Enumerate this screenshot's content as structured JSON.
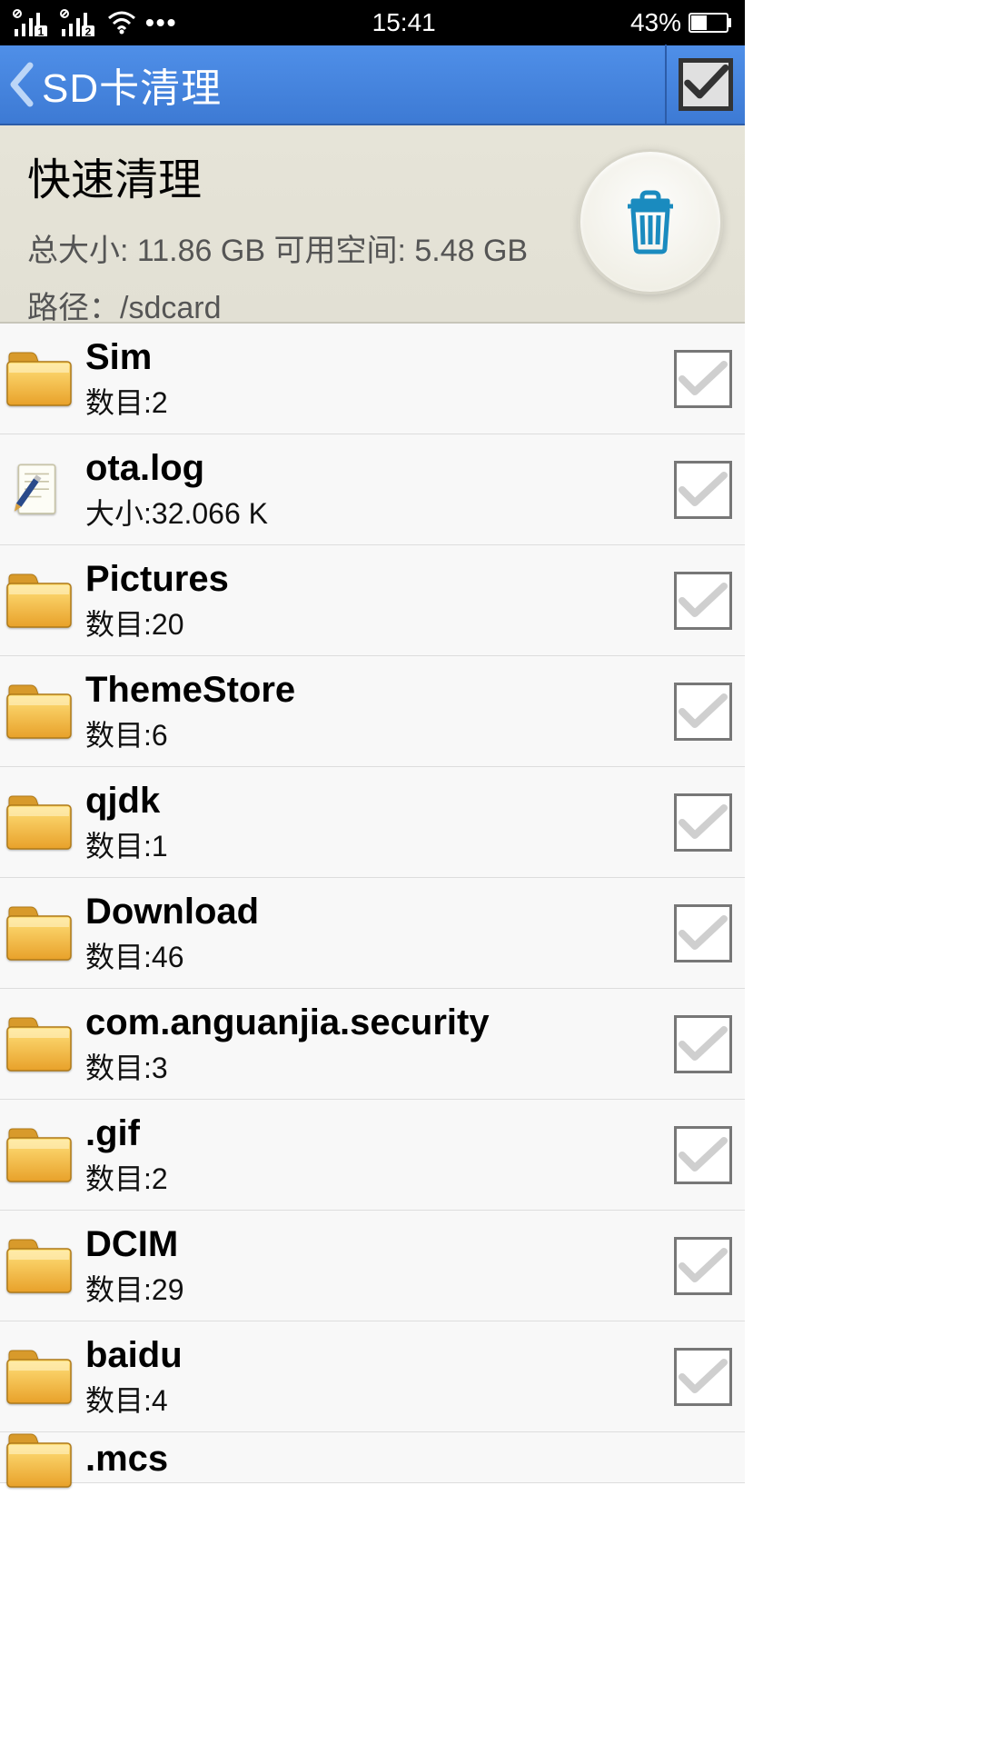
{
  "status": {
    "time": "15:41",
    "battery": "43%",
    "sim1": "1",
    "sim2": "2"
  },
  "header": {
    "title": "SD卡清理"
  },
  "summary": {
    "title": "快速清理",
    "stats": "总大小: 11.86 GB 可用空间: 5.48 GB",
    "path": "路径：/sdcard"
  },
  "items": [
    {
      "type": "folder",
      "name": "Sim",
      "sub": "数目:2"
    },
    {
      "type": "file",
      "name": "ota.log",
      "sub": "大小:32.066   K"
    },
    {
      "type": "folder",
      "name": "Pictures",
      "sub": "数目:20"
    },
    {
      "type": "folder",
      "name": "ThemeStore",
      "sub": "数目:6"
    },
    {
      "type": "folder",
      "name": "qjdk",
      "sub": "数目:1"
    },
    {
      "type": "folder",
      "name": "Download",
      "sub": "数目:46"
    },
    {
      "type": "folder",
      "name": "com.anguanjia.security",
      "sub": "数目:3"
    },
    {
      "type": "folder",
      "name": ".gif",
      "sub": "数目:2"
    },
    {
      "type": "folder",
      "name": "DCIM",
      "sub": "数目:29"
    },
    {
      "type": "folder",
      "name": "baidu",
      "sub": "数目:4"
    },
    {
      "type": "folder",
      "name": ".mcs",
      "sub": ""
    }
  ]
}
